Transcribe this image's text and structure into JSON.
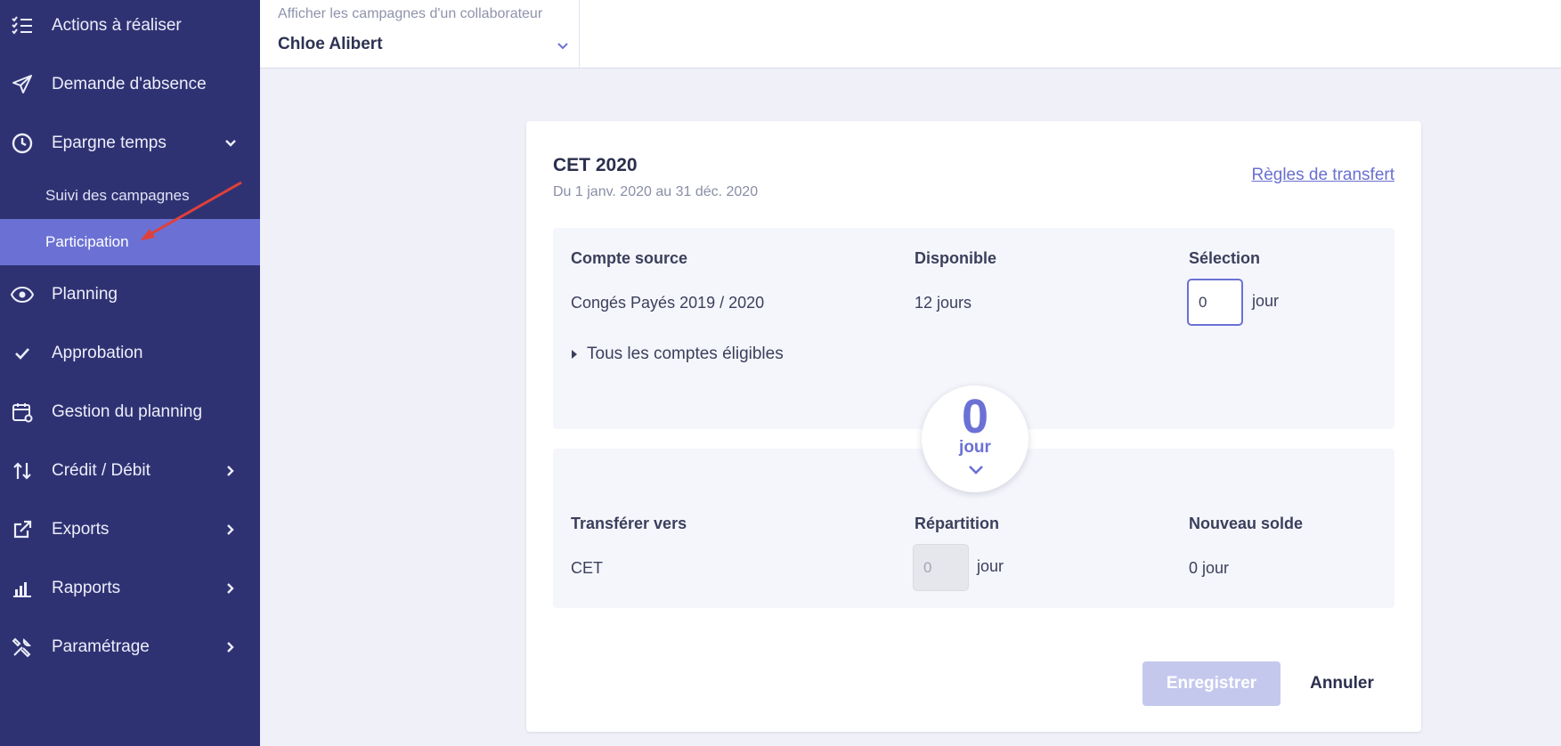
{
  "sidebar": {
    "items": [
      {
        "label": "Actions à réaliser",
        "icon": "checklist-icon"
      },
      {
        "label": "Demande d'absence",
        "icon": "send-icon"
      },
      {
        "label": "Epargne temps",
        "icon": "clock-icon"
      },
      {
        "label": "Planning",
        "icon": "eye-icon"
      },
      {
        "label": "Approbation",
        "icon": "check-icon"
      },
      {
        "label": "Gestion du planning",
        "icon": "calendar-settings-icon"
      },
      {
        "label": "Crédit / Débit",
        "icon": "up-down-arrows-icon"
      },
      {
        "label": "Exports",
        "icon": "external-link-icon"
      },
      {
        "label": "Rapports",
        "icon": "bar-chart-icon"
      },
      {
        "label": "Paramétrage",
        "icon": "tools-icon"
      }
    ],
    "subitems": [
      {
        "label": "Suivi des campagnes"
      },
      {
        "label": "Participation"
      }
    ],
    "active_subitem": "Participation",
    "bg_color": "#2f3272",
    "active_color": "#6b71d4"
  },
  "topbar": {
    "collab_hint": "Afficher les campagnes d'un collaborateur",
    "collab_value": "Chloe Alibert"
  },
  "card": {
    "title": "CET 2020",
    "period": "Du 1 janv. 2020 au 31 déc. 2020",
    "rules_link": "Règles de transfert",
    "source": {
      "headers": [
        "Compte source",
        "Disponible",
        "Sélection"
      ],
      "row": {
        "account": "Congés Payés 2019 / 2020",
        "available": "12 jours",
        "selection_value": "0",
        "selection_unit": "jour"
      },
      "expander": "Tous les comptes éligibles"
    },
    "total": {
      "value": "0",
      "unit": "jour"
    },
    "target": {
      "headers": [
        "Transférer vers",
        "Répartition",
        "Nouveau solde"
      ],
      "row": {
        "account": "CET",
        "distribution_value": "0",
        "distribution_unit": "jour",
        "new_balance": "0 jour"
      }
    },
    "save_label": "Enregistrer",
    "cancel_label": "Annuler"
  },
  "accent_color": "#6b71d4",
  "annotation_color": "#e0403a"
}
